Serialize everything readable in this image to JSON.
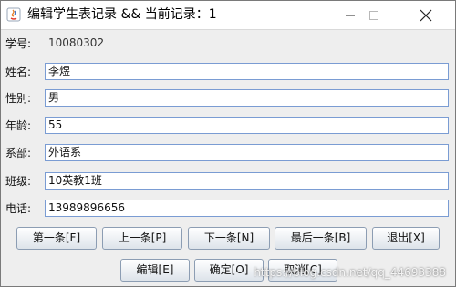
{
  "window": {
    "title": "编辑学生表记录 && 当前记录：1"
  },
  "form": {
    "fields": [
      {
        "label": "学号:",
        "value": "10080302"
      },
      {
        "label": "姓名:",
        "value": "李煜"
      },
      {
        "label": "性别:",
        "value": "男"
      },
      {
        "label": "年龄:",
        "value": "55"
      },
      {
        "label": "系部:",
        "value": "外语系"
      },
      {
        "label": "班级:",
        "value": "10英教1班"
      },
      {
        "label": "电话:",
        "value": "13989896656"
      }
    ]
  },
  "nav_buttons": {
    "first": "第一条[F]",
    "prev": "上一条[P]",
    "next": "下一条[N]",
    "last": "最后一条[B]",
    "exit": "退出[X]"
  },
  "action_buttons": {
    "edit": "编辑[E]",
    "confirm": "确定[O]",
    "cancel": "取消[C]"
  },
  "watermark": "https://blog.csdn.net/qq_44693388"
}
